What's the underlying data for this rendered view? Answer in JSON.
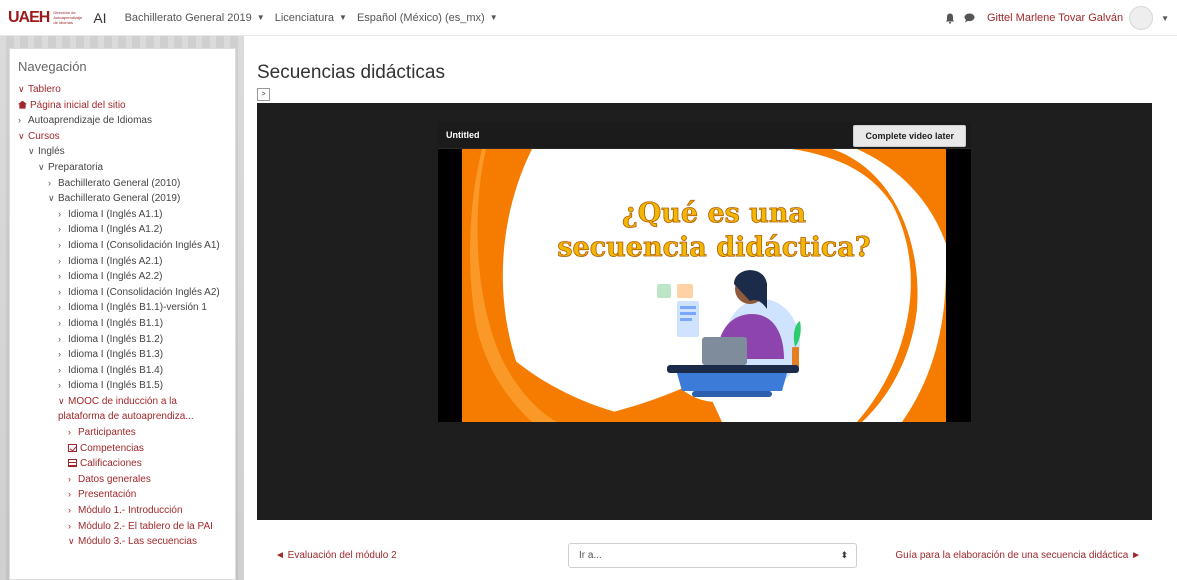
{
  "navbar": {
    "logo_mark": "UAEH",
    "logo_sub": [
      "Dirección de",
      "Autoaprendizaje",
      "de Idiomas"
    ],
    "site_short": "AI",
    "menu": [
      {
        "label": "Bachillerato General 2019"
      },
      {
        "label": "Licenciatura"
      },
      {
        "label": "Español (México) (es_mx)"
      }
    ],
    "user_name": "Gittel Marlene Tovar Galván"
  },
  "sidebar": {
    "title": "Navegación",
    "items": [
      {
        "label": "Tablero",
        "arrow": "∨",
        "link": true
      },
      {
        "label": "Página inicial del sitio",
        "arrow": "",
        "link": true,
        "icon": "home"
      },
      {
        "label": "Autoaprendizaje de Idiomas",
        "arrow": "›",
        "link": false
      },
      {
        "label": "Cursos",
        "arrow": "∨",
        "link": true
      },
      {
        "label": "Inglés",
        "arrow": "∨",
        "link": false
      },
      {
        "label": "Preparatoria",
        "arrow": "∨",
        "link": false
      },
      {
        "label": "Bachillerato General (2010)",
        "arrow": "›",
        "link": false
      },
      {
        "label": "Bachillerato General (2019)",
        "arrow": "∨",
        "link": false
      },
      {
        "label": "Idioma I (Inglés A1.1)",
        "arrow": "›",
        "link": false
      },
      {
        "label": "Idioma I (Inglés A1.2)",
        "arrow": "›",
        "link": false
      },
      {
        "label": "Idioma I (Consolidación Inglés A1)",
        "arrow": "›",
        "link": false
      },
      {
        "label": "Idioma I (Inglés A2.1)",
        "arrow": "›",
        "link": false
      },
      {
        "label": "Idioma I (Inglés A2.2)",
        "arrow": "›",
        "link": false
      },
      {
        "label": "Idioma I (Consolidación Inglés A2)",
        "arrow": "›",
        "link": false
      },
      {
        "label": "Idioma I (Inglés B1.1)-versión 1",
        "arrow": "›",
        "link": false
      },
      {
        "label": "Idioma I (Inglés B1.1)",
        "arrow": "›",
        "link": false
      },
      {
        "label": "Idioma I (Inglés B1.2)",
        "arrow": "›",
        "link": false
      },
      {
        "label": "Idioma I (Inglés B1.3)",
        "arrow": "›",
        "link": false
      },
      {
        "label": "Idioma I (Inglés B1.4)",
        "arrow": "›",
        "link": false
      },
      {
        "label": "Idioma I (Inglés B1.5)",
        "arrow": "›",
        "link": false
      },
      {
        "label": "MOOC de inducción a la plataforma de autoaprendiza...",
        "arrow": "∨",
        "link": true
      },
      {
        "label": "Participantes",
        "arrow": "›",
        "link": true
      },
      {
        "label": "Competencias",
        "arrow": "",
        "link": true,
        "icon": "check"
      },
      {
        "label": "Calificaciones",
        "arrow": "",
        "link": true,
        "icon": "table"
      },
      {
        "label": "Datos generales",
        "arrow": "›",
        "link": true
      },
      {
        "label": "Presentación",
        "arrow": "›",
        "link": true
      },
      {
        "label": "Módulo 1.- Introducción",
        "arrow": "›",
        "link": true
      },
      {
        "label": "Módulo 2.- El tablero de la PAI",
        "arrow": "›",
        "link": true
      },
      {
        "label": "Módulo 3.- Las secuencias",
        "arrow": "∨",
        "link": true
      }
    ]
  },
  "main": {
    "page_title": "Secuencias didácticas",
    "toggle_label": ">"
  },
  "player": {
    "title": "Untitled",
    "complete_button": "Complete video later",
    "slide_heading_line1": "¿Qué es una",
    "slide_heading_line2": "secuencia didáctica?"
  },
  "footer_nav": {
    "prev_label": "◄ Evaluación del módulo 2",
    "jump_placeholder": "Ir a...",
    "next_label": "Guía para la elaboración de una secuencia didáctica ►"
  },
  "colors": {
    "brand": "#a0282c",
    "video_bg": "#1e1e1e",
    "slide_orange": "#f57c00",
    "slide_title": "#f2b705"
  }
}
